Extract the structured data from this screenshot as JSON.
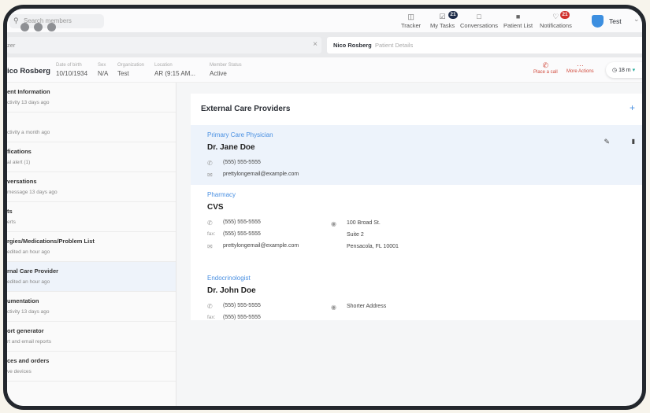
{
  "topbar": {
    "search_placeholder": "Search members",
    "nav": [
      {
        "label": "Tracker",
        "icon": "tracker-icon"
      },
      {
        "label": "My Tasks",
        "icon": "tasks-icon",
        "badge": "21"
      },
      {
        "label": "Conversations",
        "icon": "chat-icon"
      },
      {
        "label": "Patient List",
        "icon": "patient-list-icon"
      },
      {
        "label": "Notifications",
        "icon": "bell-icon",
        "badge": "21"
      }
    ],
    "user": "Test",
    "badge_colors": {
      "tasks": "#1f2d4a",
      "notifications": "#d0312d"
    }
  },
  "tabs": {
    "left": "zer",
    "right_name": "Nico Rosberg",
    "right_sub": "Patient Details"
  },
  "patient": {
    "name": "ico Rosberg",
    "fields": [
      {
        "label": "Date of birth",
        "value": "10/10/1934"
      },
      {
        "label": "Sex",
        "value": "N/A"
      },
      {
        "label": "Organization",
        "value": "Test"
      },
      {
        "label": "Location",
        "value": "AR (9:15 AM..."
      },
      {
        "label": "Member Status",
        "value": "Active"
      }
    ],
    "place_call": "Place a call",
    "more_actions": "More Actions",
    "timer": "18 m",
    "accent": "#d0483a"
  },
  "sidebar": [
    {
      "title": "ent Information",
      "sub": "ctivity 13 days ago"
    },
    {
      "title": "",
      "sub": "ctivity a month ago"
    },
    {
      "title": "fications",
      "sub": "al alert (1)"
    },
    {
      "title": "versations",
      "sub": "message 13 days ago"
    },
    {
      "title": "ts",
      "sub": "erts"
    },
    {
      "title": "rgies/Medications/Problem List",
      "sub": "edited an hour ago"
    },
    {
      "title": "rnal Care Provider",
      "sub": "edited an hour ago"
    },
    {
      "title": "umentation",
      "sub": "ctivity 13 days ago"
    },
    {
      "title": "ort generator",
      "sub": "rt and email reports"
    },
    {
      "title": "ces and orders",
      "sub": "ve devices"
    }
  ],
  "main": {
    "title": "External Care Providers",
    "add": "+",
    "fax_label": "fax:",
    "providers": [
      {
        "category": "Primary Care Physician",
        "name": "Dr. Jane Doe",
        "phone": "(555) 555-5555",
        "email": "prettylongemail@example.com"
      },
      {
        "category": "Pharmacy",
        "name": "CVS",
        "phone": "(555) 555-5555",
        "fax": "(555) 555-5555",
        "email": "prettylongemail@example.com",
        "address": [
          "100 Broad St.",
          "Suite 2",
          "Pensacola, FL 10001"
        ]
      },
      {
        "category": "Endocrinologist",
        "name": "Dr. John Doe",
        "phone": "(555) 555-5555",
        "fax": "(555) 555-5555",
        "address": [
          "Shorter Address"
        ]
      }
    ]
  }
}
